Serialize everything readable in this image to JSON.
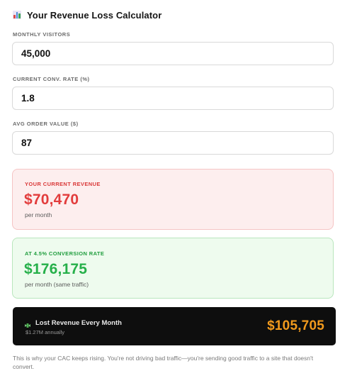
{
  "header": {
    "title": "Your Revenue Loss Calculator",
    "icon": "bar-chart-icon"
  },
  "fields": [
    {
      "label": "MONTHLY VISITORS",
      "value": "45,000"
    },
    {
      "label": "CURRENT CONV. RATE (%)",
      "value": "1.8"
    },
    {
      "label": "AVG ORDER VALUE ($)",
      "value": "87"
    }
  ],
  "current_revenue": {
    "label": "YOUR CURRENT REVENUE",
    "amount": "$70,470",
    "period": "per month",
    "color": "#e23c3c"
  },
  "target_revenue": {
    "label": "AT 4.5% CONVERSION RATE",
    "amount": "$176,175",
    "period": "per month (same traffic)",
    "color": "#26b04a"
  },
  "lost_revenue": {
    "icon": "money-wings-icon",
    "title": "Lost Revenue Every Month",
    "annual": "$1.27M annually",
    "amount": "$105,705",
    "color": "#f29a1d"
  },
  "footnote": "This is why your CAC keeps rising. You're not driving bad traffic—you're sending good traffic to a site that doesn't convert."
}
